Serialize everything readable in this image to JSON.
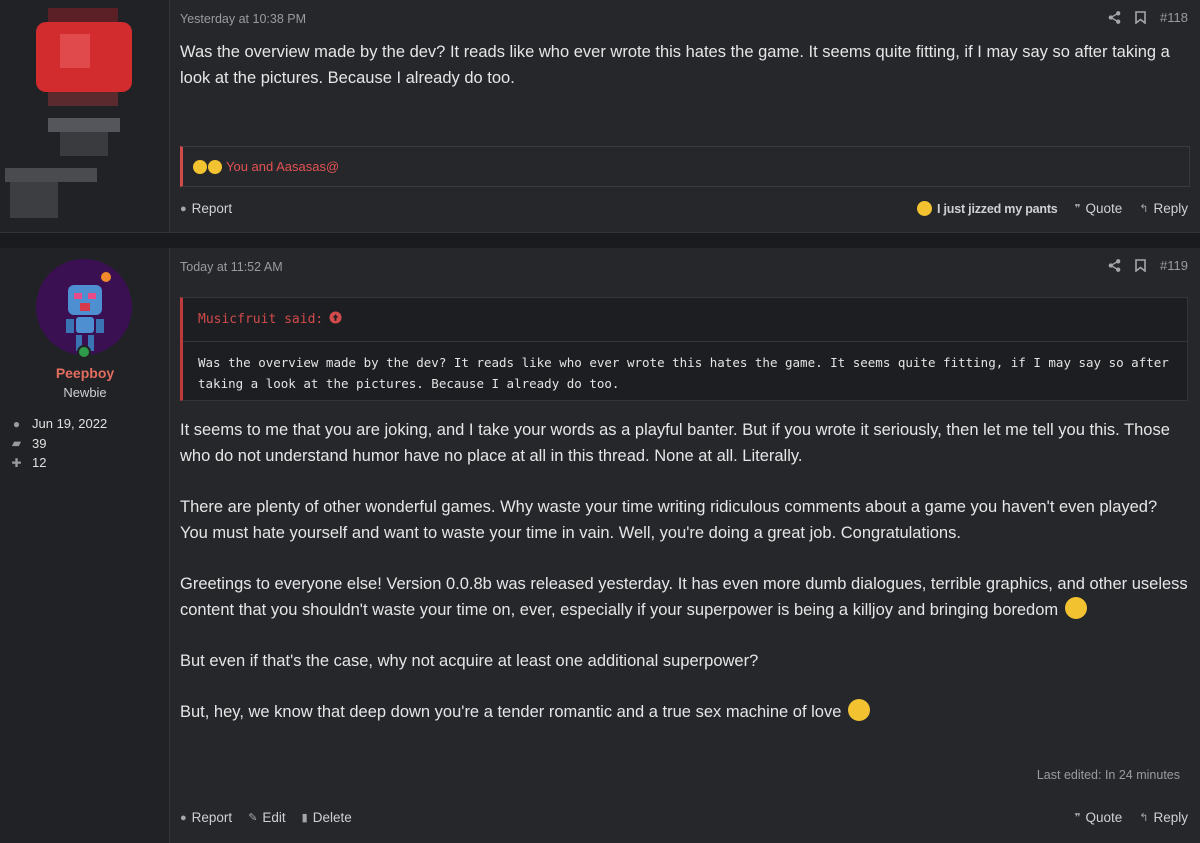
{
  "posts": [
    {
      "timestamp": "Yesterday at 10:38 PM",
      "number": "#118",
      "body": "Was the overview made by the dev? It reads like who ever wrote this hates the game. It seems quite fitting, if I may say so after taking a look at the pictures. Because I already do too.",
      "reactions_text": "You and Aasasas@",
      "actions": {
        "report": "Report",
        "reaction": "I just jizzed my pants",
        "quote": "Quote",
        "reply": "Reply"
      }
    },
    {
      "timestamp": "Today at 11:52 AM",
      "number": "#119",
      "user": {
        "name": "Peepboy",
        "title": "Newbie",
        "joined": "Jun 19, 2022",
        "messages": "39",
        "reactions": "12"
      },
      "quote": {
        "author": "Musicfruit said:",
        "text": "Was the overview made by the dev? It reads like who ever wrote this hates the game. It seems quite fitting, if I may say so after taking a look at the pictures. Because I already do too."
      },
      "paragraphs": [
        "It seems to me that you are joking, and I take your words as a playful banter. But if you wrote it seriously, then let me tell you this. Those who do not understand humor have no place at all in this thread. None at all. Literally.",
        "There are plenty of other wonderful games. Why waste your time writing ridiculous comments about a game you haven't even played? You must hate yourself and want to waste your time in vain. Well, you're doing a great job. Congratulations.",
        "Greetings to everyone else! Version 0.0.8b was released yesterday. It has even more dumb dialogues, terrible graphics, and other useless content that you shouldn't waste your time on, ever, especially if your superpower is being a killjoy and bringing boredom",
        "But even if that's the case, why not acquire at least one additional superpower?",
        "But, hey, we know that deep down you're a tender romantic and a true sex machine of love"
      ],
      "edited": "Last edited: In 24 minutes",
      "actions": {
        "report": "Report",
        "edit": "Edit",
        "delete": "Delete",
        "quote": "Quote",
        "reply": "Reply"
      }
    }
  ],
  "colors": {
    "accent_red": "#d14b4b",
    "username": "#e36d5f",
    "online": "#2e9b4b"
  },
  "icons": [
    "share-icon",
    "bookmark-icon",
    "report-icon",
    "edit-icon",
    "delete-icon",
    "quote-icon",
    "reply-icon",
    "user-icon",
    "messages-icon",
    "thumbs-up-icon",
    "arrow-up-circle-icon"
  ]
}
